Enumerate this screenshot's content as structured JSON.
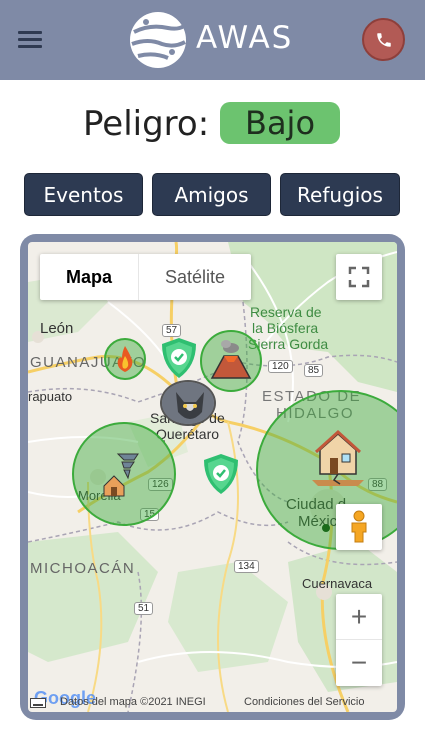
{
  "app": {
    "brand": "AWAS",
    "menu_icon": "hamburger-menu-icon",
    "call_icon": "phone-icon"
  },
  "danger": {
    "label": "Peligro:",
    "level": "Bajo",
    "level_color": "#6cc36f"
  },
  "nav": {
    "events": "Eventos",
    "friends": "Amigos",
    "shelters": "Refugios"
  },
  "map": {
    "type_map": "Mapa",
    "type_satellite": "Satélite",
    "labels": {
      "leon": "León",
      "guanajuato": "GUANAJUATO",
      "irapuato": "rapuato",
      "reserva1": "Reserva de",
      "reserva2": "la Biósfera",
      "reserva3": "Sierra Gorda",
      "estado_de": "ESTADO DE",
      "hidalgo": "HIDALGO",
      "santiago1": "Santiago de",
      "santiago2": "Querétaro",
      "morelia": "Morelia",
      "michoacan": "MICHOACÁN",
      "ciudad1": "Ciudad d",
      "ciudad2": "México",
      "cuernavaca": "Cuernavaca",
      "r57": "57",
      "r120": "120",
      "r85": "85",
      "r126": "126",
      "r15": "15",
      "r134": "134",
      "r51": "51",
      "r88": "88"
    },
    "attribution": "Datos del mapa ©2021 INEGI",
    "terms": "Condiciones del Servicio",
    "google": "Google",
    "zoom_in": "+",
    "zoom_out": "−",
    "markers": [
      {
        "name": "fire-event",
        "icon": "fire-icon"
      },
      {
        "name": "shelter-1",
        "icon": "shield-check-icon"
      },
      {
        "name": "volcano-event",
        "icon": "volcano-icon"
      },
      {
        "name": "friend-avatar",
        "icon": "wolf-avatar-icon"
      },
      {
        "name": "tornado-event",
        "icon": "tornado-icon"
      },
      {
        "name": "shelter-2",
        "icon": "shield-check-icon"
      },
      {
        "name": "earthquake-event",
        "icon": "earthquake-icon"
      }
    ],
    "colors": {
      "event_circle": "#3cab3c",
      "shelter": "#2fbf71"
    }
  }
}
